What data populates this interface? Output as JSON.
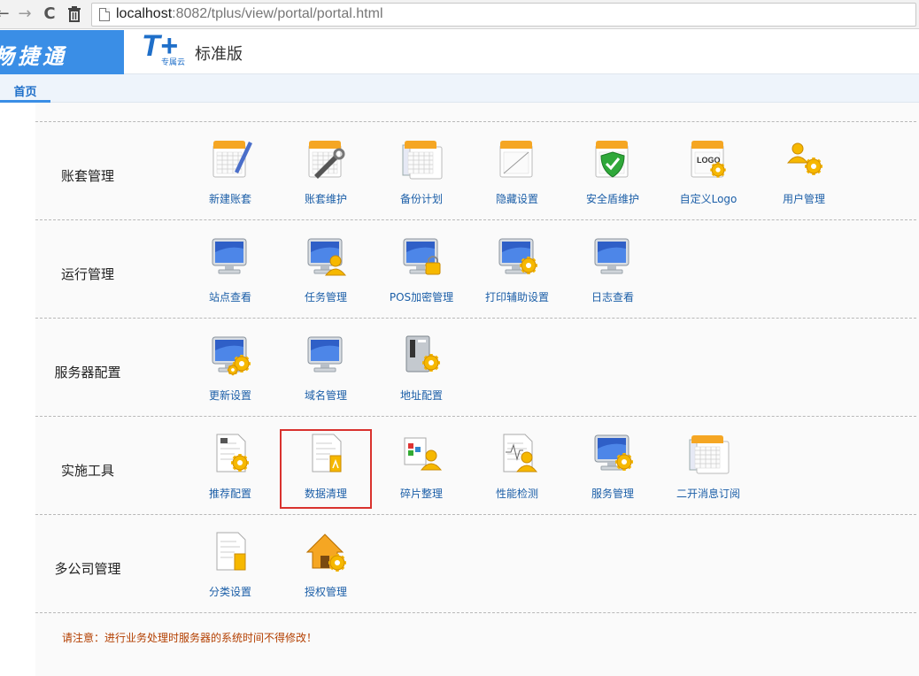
{
  "browser": {
    "url_host": "localhost",
    "url_rest": ":8082/tplus/view/portal/portal.html",
    "back_glyph": "←",
    "forward_glyph": "→",
    "reload_glyph": "C",
    "trash_glyph": "🗑"
  },
  "header": {
    "brand": "畅捷通",
    "logo_mark": "T+",
    "logo_sub": "专属云",
    "edition": "标准版"
  },
  "tabs": [
    {
      "label": "首页"
    }
  ],
  "sections": [
    {
      "title": "账套管理",
      "items": [
        {
          "label": "新建账套",
          "icon": "ledger-pen-icon"
        },
        {
          "label": "账套维护",
          "icon": "ledger-wrench-icon"
        },
        {
          "label": "备份计划",
          "icon": "backup-plan-icon"
        },
        {
          "label": "隐藏设置",
          "icon": "hide-settings-icon"
        },
        {
          "label": "安全盾维护",
          "icon": "security-shield-icon"
        },
        {
          "label": "自定义Logo",
          "icon": "custom-logo-icon"
        },
        {
          "label": "用户管理",
          "icon": "user-gear-icon"
        }
      ]
    },
    {
      "title": "运行管理",
      "items": [
        {
          "label": "站点查看",
          "icon": "monitor-icon"
        },
        {
          "label": "任务管理",
          "icon": "monitor-user-icon"
        },
        {
          "label": "POS加密管理",
          "icon": "monitor-lock-icon"
        },
        {
          "label": "打印辅助设置",
          "icon": "monitor-gear-icon"
        },
        {
          "label": "日志查看",
          "icon": "monitor-log-icon"
        }
      ]
    },
    {
      "title": "服务器配置",
      "items": [
        {
          "label": "更新设置",
          "icon": "monitor-update-gear-icon"
        },
        {
          "label": "域名管理",
          "icon": "monitor-domain-icon"
        },
        {
          "label": "地址配置",
          "icon": "server-gear-icon"
        }
      ]
    },
    {
      "title": "实施工具",
      "items": [
        {
          "label": "推荐配置",
          "icon": "document-gear-icon"
        },
        {
          "label": "数据清理",
          "icon": "data-cleanup-icon",
          "selected": true
        },
        {
          "label": "碎片整理",
          "icon": "defrag-user-icon"
        },
        {
          "label": "性能检测",
          "icon": "performance-user-icon"
        },
        {
          "label": "服务管理",
          "icon": "service-monitor-gear-icon"
        },
        {
          "label": "二开消息订阅",
          "icon": "message-subscribe-icon"
        }
      ]
    },
    {
      "title": "多公司管理",
      "items": [
        {
          "label": "分类设置",
          "icon": "category-doc-icon"
        },
        {
          "label": "授权管理",
          "icon": "house-gear-icon"
        }
      ]
    }
  ],
  "notice": "请注意：进行业务处理时服务器的系统时间不得修改！",
  "colors": {
    "brand_blue": "#3a8ee6",
    "link_blue": "#1c5fa8",
    "selection_red": "#d9322e",
    "notice_orange": "#b33f00",
    "folder_orange": "#f5a623",
    "gear_yellow": "#f6b800"
  }
}
